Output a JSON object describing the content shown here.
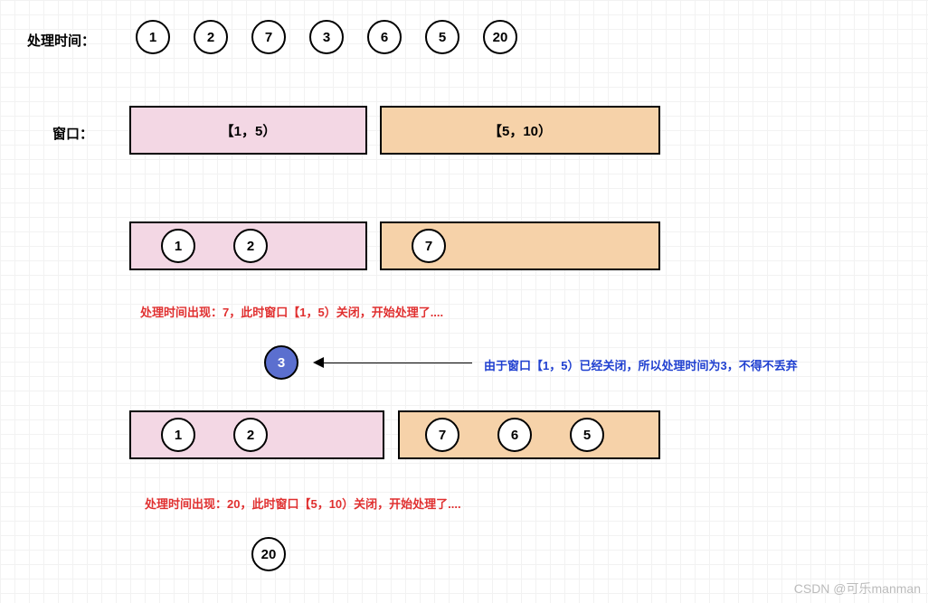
{
  "labels": {
    "proc_time": "处理时间：",
    "window": "窗口："
  },
  "top_circles": [
    "1",
    "2",
    "7",
    "3",
    "6",
    "5",
    "20"
  ],
  "windows_row1": {
    "left": "【1，5）",
    "right": "【5，10）"
  },
  "row2_left_circles": [
    "1",
    "2"
  ],
  "row2_right_circles": [
    "7"
  ],
  "note1": "处理时间出现：7，此时窗口【1，5）关闭，开始处理了....",
  "blue_circle": "3",
  "note2": "由于窗口【1，5）已经关闭，所以处理时间为3，不得不丢弃",
  "row3_left_circles": [
    "1",
    "2"
  ],
  "row3_right_circles": [
    "7",
    "6",
    "5"
  ],
  "note3": "处理时间出现：20，此时窗口【5，10）关闭，开始处理了....",
  "bottom_circle": "20",
  "watermark": "CSDN @可乐manman"
}
